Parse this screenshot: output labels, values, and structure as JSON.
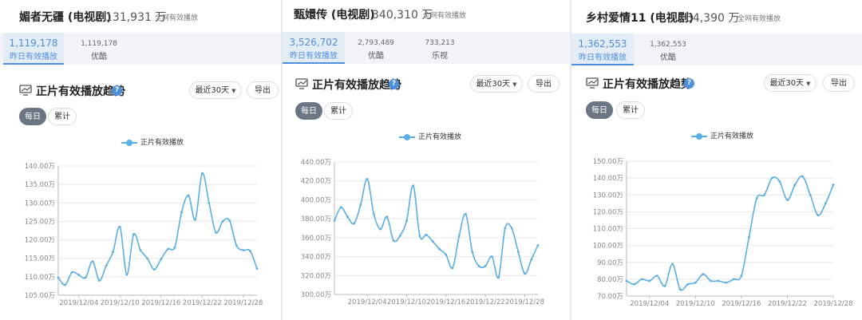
{
  "panels": [
    {
      "title": "媚者无疆 (电视剧)",
      "plays": "131,931 万",
      "plays_note": "全网有效播放",
      "stats": [
        {
          "num": "1,119,178",
          "label": "昨日有效播放",
          "active": true
        },
        {
          "num": "1,119,178",
          "label": "优酷",
          "active": false
        }
      ],
      "section_title": "正片有效播放趋势",
      "range_label": "最近30天",
      "export_label": "导出",
      "toggle": [
        "每日",
        "累计"
      ]
    },
    {
      "title": "甄嬛传 (电视剧)",
      "plays": "340,310 万",
      "plays_note": "全网有效播放",
      "stats": [
        {
          "num": "3,526,702",
          "label": "昨日有效播放",
          "active": true
        },
        {
          "num": "2,793,489",
          "label": "优酷",
          "active": false
        },
        {
          "num": "733,213",
          "label": "乐视",
          "active": false
        }
      ],
      "section_title": "正片有效播放趋势",
      "range_label": "最近30天",
      "export_label": "导出",
      "toggle": [
        "每日",
        "累计"
      ]
    },
    {
      "title": "乡村爱情11 (电视剧)",
      "plays": "164,390 万",
      "plays_note": "全网有效播放",
      "stats": [
        {
          "num": "1,362,553",
          "label": "昨日有效播放",
          "active": true
        },
        {
          "num": "1,362,553",
          "label": "优酷",
          "active": false
        }
      ],
      "section_title": "正片有效播放趋势",
      "range_label": "最近30天",
      "export_label": "导出",
      "toggle": [
        "每日",
        "累计"
      ]
    }
  ],
  "colors": {
    "line": "#59aee5",
    "accent": "#4e8fe0",
    "grid": "#e8e8e8"
  },
  "chart_data": [
    {
      "type": "line",
      "series": [
        {
          "name": "正片有效播放",
          "values": [
            109.8,
            107.8,
            111.2,
            110.5,
            109.8,
            114.2,
            109.0,
            113.0,
            116.8,
            123.5,
            110.6,
            121.5,
            117.2,
            115.0,
            112.0,
            114.8,
            117.5,
            118.0,
            127.5,
            132.0,
            125.5,
            138.0,
            130.0,
            122.0,
            125.0,
            125.2,
            118.5,
            117.2,
            117.0,
            112.2
          ]
        }
      ],
      "x": [
        "2019/12/01",
        "2019/12/02",
        "2019/12/03",
        "2019/12/04",
        "2019/12/05",
        "2019/12/06",
        "2019/12/07",
        "2019/12/08",
        "2019/12/09",
        "2019/12/10",
        "2019/12/11",
        "2019/12/12",
        "2019/12/13",
        "2019/12/14",
        "2019/12/15",
        "2019/12/16",
        "2019/12/17",
        "2019/12/18",
        "2019/12/19",
        "2019/12/20",
        "2019/12/21",
        "2019/12/22",
        "2019/12/23",
        "2019/12/24",
        "2019/12/25",
        "2019/12/26",
        "2019/12/27",
        "2019/12/28",
        "2019/12/29",
        "2019/12/30"
      ],
      "x_tick_labels": [
        "2019/12/04",
        "2019/12/10",
        "2019/12/16",
        "2019/12/22",
        "2019/12/28"
      ],
      "y_ticks": [
        "105.00万",
        "110.00万",
        "115.00万",
        "120.00万",
        "125.00万",
        "130.00万",
        "135.00万",
        "140.00万"
      ],
      "ylim": [
        105,
        140
      ],
      "legend": "top-center",
      "grid": true
    },
    {
      "type": "line",
      "series": [
        {
          "name": "正片有效播放",
          "values": [
            378,
            392,
            382,
            375,
            395,
            422,
            385,
            369,
            382,
            357,
            362,
            378,
            415,
            362,
            363,
            356,
            348,
            342,
            328,
            362,
            385,
            345,
            330,
            330,
            340,
            318,
            370,
            370,
            345,
            322,
            337,
            352
          ]
        }
      ],
      "x": [
        "2019/11/29",
        "2019/11/30",
        "2019/12/01",
        "2019/12/02",
        "2019/12/03",
        "2019/12/04",
        "2019/12/05",
        "2019/12/06",
        "2019/12/07",
        "2019/12/08",
        "2019/12/09",
        "2019/12/10",
        "2019/12/11",
        "2019/12/12",
        "2019/12/13",
        "2019/12/14",
        "2019/12/15",
        "2019/12/16",
        "2019/12/17",
        "2019/12/18",
        "2019/12/19",
        "2019/12/20",
        "2019/12/21",
        "2019/12/22",
        "2019/12/23",
        "2019/12/24",
        "2019/12/25",
        "2019/12/26",
        "2019/12/27",
        "2019/12/28",
        "2019/12/29",
        "2019/12/30"
      ],
      "x_tick_labels": [
        "2019/12/04",
        "2019/12/10",
        "2019/12/16",
        "2019/12/22",
        "2019/12/28"
      ],
      "y_ticks": [
        "300.00万",
        "320.00万",
        "340.00万",
        "360.00万",
        "380.00万",
        "400.00万",
        "420.00万",
        "440.00万"
      ],
      "ylim": [
        300,
        440
      ],
      "legend": "top-center",
      "grid": true
    },
    {
      "type": "line",
      "series": [
        {
          "name": "正片有效播放",
          "values": [
            79,
            77,
            80,
            79,
            82,
            76,
            89,
            74,
            77,
            78,
            83,
            79,
            79,
            78,
            80,
            82,
            105,
            128,
            130,
            140,
            138,
            127,
            136,
            141,
            130,
            118,
            125,
            136
          ]
        }
      ],
      "x": [
        "2019/12/01",
        "2019/12/02",
        "2019/12/03",
        "2019/12/04",
        "2019/12/05",
        "2019/12/06",
        "2019/12/07",
        "2019/12/08",
        "2019/12/09",
        "2019/12/10",
        "2019/12/11",
        "2019/12/12",
        "2019/12/13",
        "2019/12/14",
        "2019/12/15",
        "2019/12/16",
        "2019/12/17",
        "2019/12/18",
        "2019/12/19",
        "2019/12/20",
        "2019/12/21",
        "2019/12/22",
        "2019/12/23",
        "2019/12/24",
        "2019/12/25",
        "2019/12/26",
        "2019/12/27",
        "2019/12/28"
      ],
      "x_tick_labels": [
        "2019/12/04",
        "2019/12/10",
        "2019/12/16",
        "2019/12/22",
        "2019/12/28"
      ],
      "y_ticks": [
        "70.00万",
        "80.00万",
        "90.00万",
        "100.00万",
        "110.00万",
        "120.00万",
        "130.00万",
        "140.00万",
        "150.00万"
      ],
      "ylim": [
        70,
        150
      ],
      "legend": "top-center",
      "grid": true
    }
  ]
}
